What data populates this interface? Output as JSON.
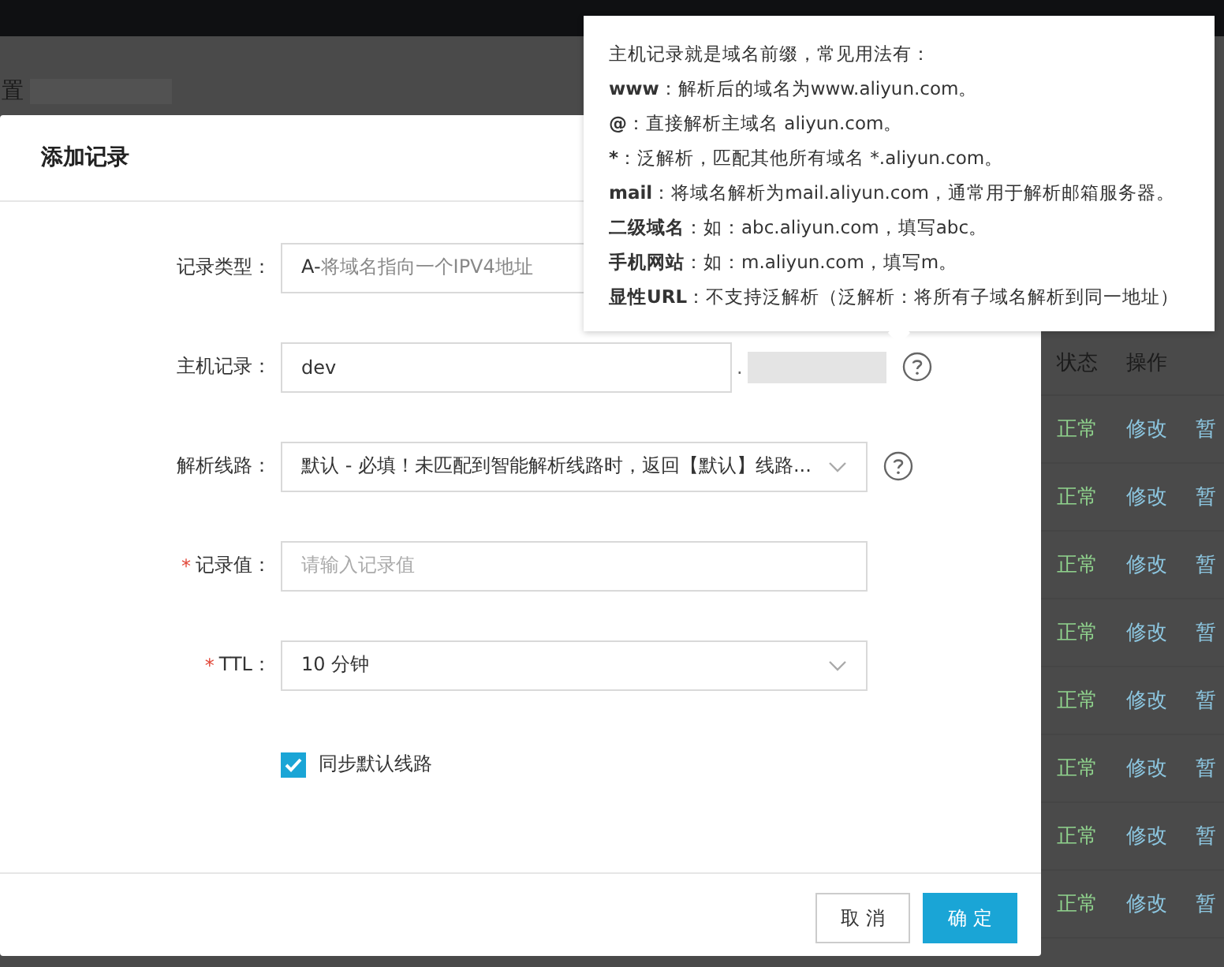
{
  "page_title": "置",
  "table": {
    "columns": [
      "状态",
      "操作"
    ],
    "rows": [
      {
        "status": "正常",
        "edit": "修改",
        "pause": "暂"
      },
      {
        "status": "正常",
        "edit": "修改",
        "pause": "暂"
      },
      {
        "status": "正常",
        "edit": "修改",
        "pause": "暂"
      },
      {
        "status": "正常",
        "edit": "修改",
        "pause": "暂"
      },
      {
        "status": "正常",
        "edit": "修改",
        "pause": "暂"
      },
      {
        "status": "正常",
        "edit": "修改",
        "pause": "暂"
      },
      {
        "status": "正常",
        "edit": "修改",
        "pause": "暂"
      },
      {
        "status": "正常",
        "edit": "修改",
        "pause": "暂"
      }
    ]
  },
  "dialog": {
    "title": "添加记录",
    "fields": [
      {
        "kind": "select",
        "label": "记录类型：",
        "value": "A-",
        "description": "将域名指向一个IPV4地址"
      },
      {
        "kind": "input",
        "label": "主机记录：",
        "value": "dev",
        "suffix": ".",
        "help": true
      },
      {
        "kind": "select",
        "label": "解析线路：",
        "value": "默认 - 必填！未匹配到智能解析线路时，返回【默认】线路...",
        "help": true
      },
      {
        "kind": "input",
        "label": "记录值：",
        "required_mark": "*",
        "placeholder": "请输入记录值"
      },
      {
        "kind": "select",
        "label": "TTL：",
        "required_mark": "*",
        "value": "10 分钟"
      }
    ],
    "checkbox": {
      "label": "同步默认线路",
      "checked": true
    },
    "buttons": [
      {
        "label": "取 消",
        "primary": false
      },
      {
        "label": "确 定",
        "primary": true
      }
    ]
  },
  "tooltip": {
    "lines": [
      {
        "text": "主机记录就是域名前缀，常见用法有："
      },
      {
        "term": "www",
        "text": "：解析后的域名为www.aliyun.com。"
      },
      {
        "term": "@",
        "text": "：直接解析主域名 aliyun.com。"
      },
      {
        "term": "*",
        "text": "：泛解析，匹配其他所有域名 *.aliyun.com。"
      },
      {
        "term": "mail",
        "text": "：将域名解析为mail.aliyun.com，通常用于解析邮箱服务器。"
      },
      {
        "term": "二级域名",
        "text": "：如：abc.aliyun.com，填写abc。"
      },
      {
        "term": "手机网站",
        "text": "：如：m.aliyun.com，填写m。"
      },
      {
        "term": "显性URL",
        "text": "：不支持泛解析（泛解析：将所有子域名解析到同一地址）"
      }
    ]
  }
}
